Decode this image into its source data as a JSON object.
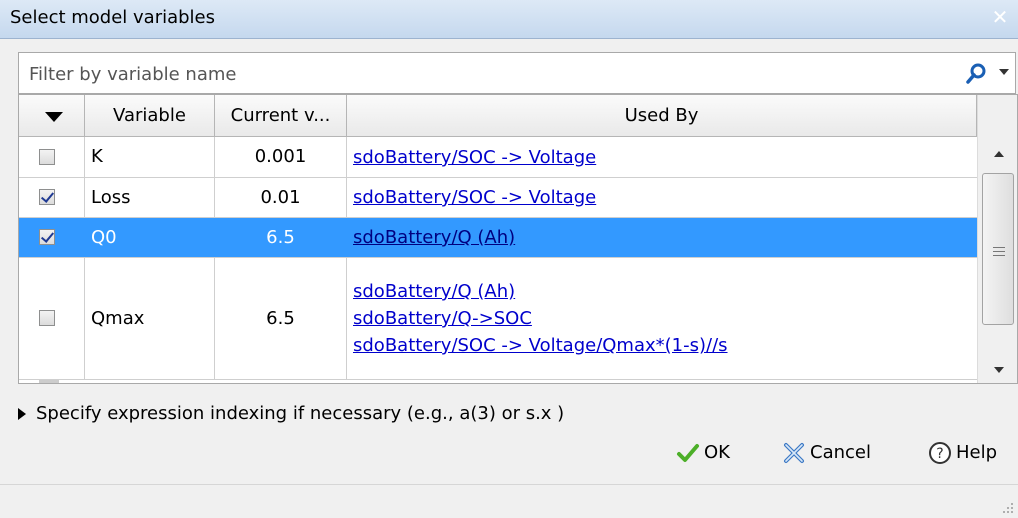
{
  "window": {
    "title": "Select model variables",
    "close_symbol": "✕"
  },
  "filter": {
    "placeholder": "Filter by variable name",
    "value": ""
  },
  "table": {
    "columns": {
      "check": "",
      "variable": "Variable",
      "current_value": "Current v...",
      "used_by": "Used By"
    },
    "rows": [
      {
        "checked": false,
        "variable": "K",
        "value": "0.001",
        "used_by": [
          "sdoBattery/SOC -> Voltage"
        ],
        "selected": false
      },
      {
        "checked": true,
        "variable": "Loss",
        "value": "0.01",
        "used_by": [
          "sdoBattery/SOC -> Voltage"
        ],
        "selected": false
      },
      {
        "checked": true,
        "variable": "Q0",
        "value": "6.5",
        "used_by": [
          "sdoBattery/Q (Ah)"
        ],
        "selected": true
      },
      {
        "checked": false,
        "variable": "Qmax",
        "value": "6.5",
        "used_by": [
          "sdoBattery/Q (Ah)",
          "sdoBattery/Q->SOC",
          "sdoBattery/SOC -> Voltage/Qmax*(1-s)//s"
        ],
        "selected": false
      }
    ]
  },
  "expander": {
    "label": "Specify expression indexing if necessary (e.g., a(3) or s.x )"
  },
  "buttons": {
    "ok": "OK",
    "cancel": "Cancel",
    "help": "Help"
  },
  "colors": {
    "selection": "#3399ff",
    "link": "#0000cc",
    "ok_check": "#4caf28",
    "cancel_x": "#3b78c4"
  },
  "icons": {
    "search": "search-icon",
    "ok": "checkmark-icon",
    "cancel": "cancel-x-icon",
    "help": "help-circle-icon"
  }
}
